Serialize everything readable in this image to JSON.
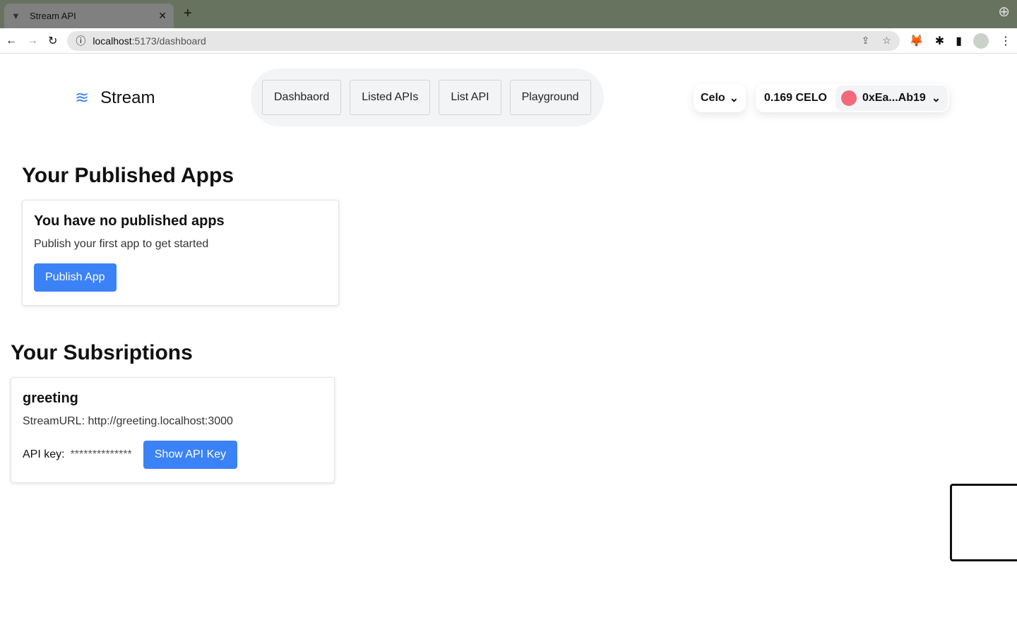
{
  "browser": {
    "tab_title": "Stream API",
    "url_host": "localhost",
    "url_path": ":5173/dashboard"
  },
  "brand": {
    "name": "Stream"
  },
  "nav": [
    {
      "label": "Dashbaord"
    },
    {
      "label": "Listed APIs"
    },
    {
      "label": "List API"
    },
    {
      "label": "Playground"
    }
  ],
  "wallet": {
    "chain": "Celo",
    "balance": "0.169 CELO",
    "address": "0xEa...Ab19"
  },
  "published": {
    "heading": "Your Published Apps",
    "empty_title": "You have no published apps",
    "empty_text": "Publish your first app to get started",
    "button": "Publish App"
  },
  "subscriptions": {
    "heading": "Your Subsriptions",
    "items": [
      {
        "name": "greeting",
        "stream_url": "StreamURL: http://greeting.localhost:3000",
        "api_key_label": "API key:",
        "api_key_masked": "**************",
        "button": "Show API Key"
      }
    ]
  },
  "colors": {
    "accent": "#3b82f6"
  }
}
